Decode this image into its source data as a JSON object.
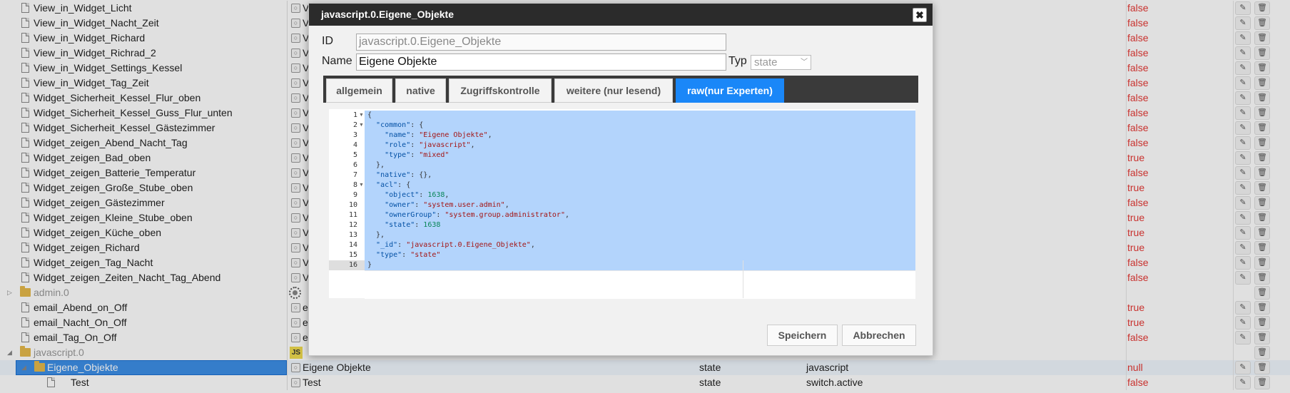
{
  "tree": {
    "rows": [
      {
        "name": "View_in_Widget_Licht",
        "col2": "V",
        "value": "false"
      },
      {
        "name": "View_in_Widget_Nacht_Zeit",
        "col2": "V",
        "value": "false"
      },
      {
        "name": "View_in_Widget_Richard",
        "col2": "V",
        "value": "false"
      },
      {
        "name": "View_in_Widget_Richrad_2",
        "col2": "V",
        "value": "false"
      },
      {
        "name": "View_in_Widget_Settings_Kessel",
        "col2": "V",
        "value": "false"
      },
      {
        "name": "View_in_Widget_Tag_Zeit",
        "col2": "V",
        "value": "false"
      },
      {
        "name": "Widget_Sicherheit_Kessel_Flur_oben",
        "col2": "V",
        "value": "false"
      },
      {
        "name": "Widget_Sicherheit_Kessel_Guss_Flur_unten",
        "col2": "V",
        "value": "false"
      },
      {
        "name": "Widget_Sicherheit_Kessel_Gästezimmer",
        "col2": "V",
        "value": "false"
      },
      {
        "name": "Widget_zeigen_Abend_Nacht_Tag",
        "col2": "V",
        "value": "false"
      },
      {
        "name": "Widget_zeigen_Bad_oben",
        "col2": "V",
        "value": "true"
      },
      {
        "name": "Widget_zeigen_Batterie_Temperatur",
        "col2": "V",
        "value": "false"
      },
      {
        "name": "Widget_zeigen_Große_Stube_oben",
        "col2": "V",
        "value": "true"
      },
      {
        "name": "Widget_zeigen_Gästezimmer",
        "col2": "V",
        "value": "false"
      },
      {
        "name": "Widget_zeigen_Kleine_Stube_oben",
        "col2": "V",
        "value": "true"
      },
      {
        "name": "Widget_zeigen_Küche_oben",
        "col2": "V",
        "value": "true"
      },
      {
        "name": "Widget_zeigen_Richard",
        "col2": "V",
        "value": "true"
      },
      {
        "name": "Widget_zeigen_Tag_Nacht",
        "col2": "V",
        "value": "false"
      },
      {
        "name": "Widget_zeigen_Zeiten_Nacht_Tag_Abend",
        "col2": "V",
        "value": "false"
      },
      {
        "name": "admin.0",
        "folder": true
      },
      {
        "name": "email_Abend_on_Off",
        "col2": "e",
        "value": "true"
      },
      {
        "name": "email_Nacht_On_Off",
        "col2": "e",
        "value": "true"
      },
      {
        "name": "email_Tag_On_Off",
        "col2": "e",
        "value": "false"
      },
      {
        "name": "javascript.0",
        "folder": true
      },
      {
        "name": "Eigene_Objekte",
        "folder": true,
        "selected": true,
        "col2": "Eigene Objekte",
        "type": "state",
        "role": "javascript",
        "value": "null"
      },
      {
        "name": "Test",
        "col2": "Test",
        "type": "state",
        "role": "switch.active",
        "value": "false"
      }
    ],
    "edit_icon": "✎",
    "delete_icon": "🗑",
    "js_badge": "JS"
  },
  "dialog": {
    "title": "javascript.0.Eigene_Objekte",
    "close_icon": "✖",
    "id_label": "ID",
    "id_value": "javascript.0.Eigene_Objekte",
    "name_label": "Name",
    "name_value": "Eigene Objekte",
    "typ_label": "Typ",
    "typ_value": "state",
    "tabs": [
      {
        "label": "allgemein"
      },
      {
        "label": "native"
      },
      {
        "label": "Zugriffskontrolle"
      },
      {
        "label": "weitere (nur lesend)"
      },
      {
        "label": "raw(nur Experten)",
        "active": true
      }
    ],
    "save_label": "Speichern",
    "cancel_label": "Abbrechen"
  },
  "colors": {
    "accent": "#1a87f8",
    "true_false": "#e53935",
    "titlebar": "#2b2b2b"
  }
}
